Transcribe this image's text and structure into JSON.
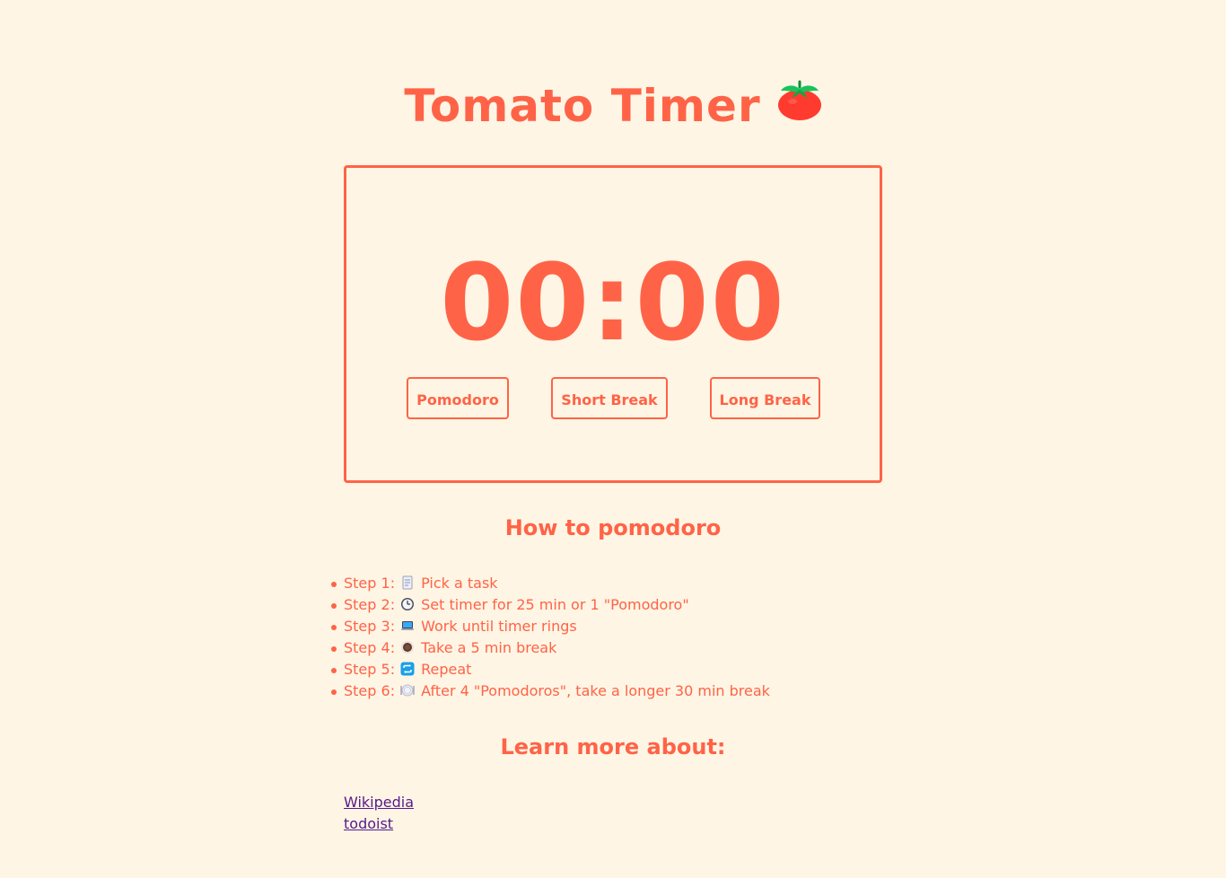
{
  "header": {
    "title": "Tomato Timer"
  },
  "timer": {
    "display": "00:00"
  },
  "modes": {
    "pomodoro_label": "Pomodoro",
    "short_break_label": "Short Break",
    "long_break_label": "Long Break"
  },
  "how_to": {
    "heading": "How to pomodoro",
    "steps": [
      {
        "num": "Step 1:",
        "icon": "memo-icon",
        "text": "Pick a task"
      },
      {
        "num": "Step 2:",
        "icon": "clock-icon",
        "text": "Set timer for 25 min or 1 \"Pomodoro\""
      },
      {
        "num": "Step 3:",
        "icon": "laptop-icon",
        "text": "Work until timer rings"
      },
      {
        "num": "Step 4:",
        "icon": "coffee-icon",
        "text": "Take a 5 min break"
      },
      {
        "num": "Step 5:",
        "icon": "repeat-icon",
        "text": "Repeat"
      },
      {
        "num": "Step 6:",
        "icon": "plate-icon",
        "text": "After 4 \"Pomodoros\", take a longer 30 min break"
      }
    ]
  },
  "learn_more": {
    "heading": "Learn more about:",
    "links": [
      {
        "label": "Wikipedia"
      },
      {
        "label": "todoist"
      }
    ]
  },
  "colors": {
    "background": "#fff5e4",
    "accent": "#ff6347",
    "visited_link": "#551a8b"
  }
}
